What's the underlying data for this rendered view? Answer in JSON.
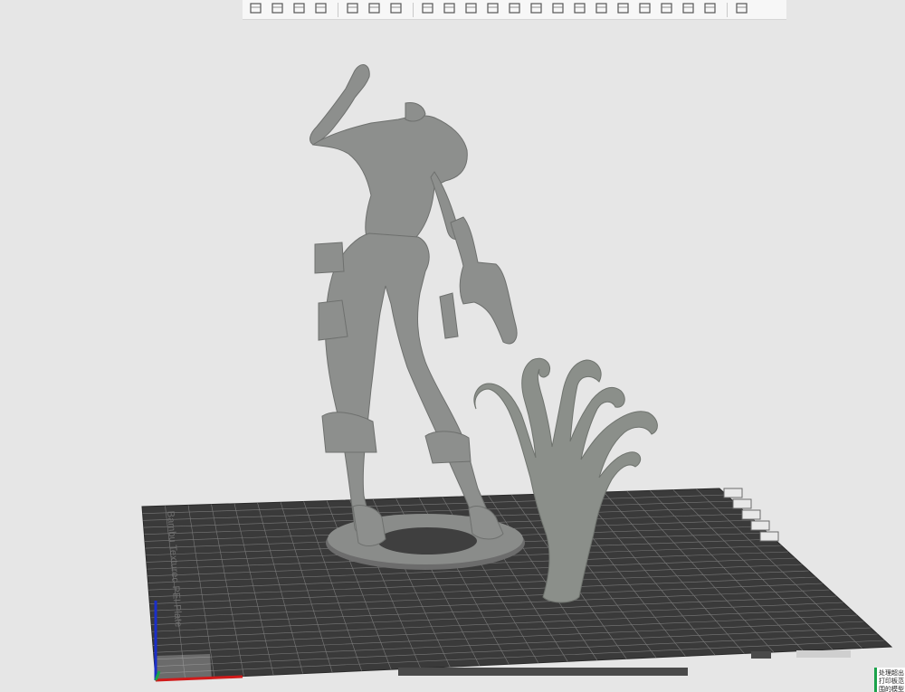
{
  "app": {
    "accent_color": "#1aa24a",
    "background_color": "#e6e6e6"
  },
  "toolbar": {
    "groups": [
      [
        "add-object-icon",
        "grid-icon",
        "auto-orient-icon",
        "arrange-icon"
      ],
      [
        "plate-icon",
        "plate-p-icon",
        "list-icon"
      ],
      [
        "move-icon",
        "rotate-icon",
        "scale-icon",
        "lay-flat-icon",
        "cut-icon",
        "split-icon",
        "mirror-icon",
        "support-paint-icon",
        "seam-icon",
        "text-emboss-icon",
        "measure-icon",
        "brim-ears-icon",
        "assembly-icon",
        "bounding-box-icon"
      ],
      [
        "variable-layer-icon"
      ]
    ]
  },
  "plate": {
    "label": "Bambu Textured PEI Plate",
    "grid_color": "#8a8a8a",
    "plate_color": "#3a3a3a",
    "side_buttons": [
      "close-plate-icon",
      "orient-plate-icon",
      "arrange-plate-icon",
      "lock-plate-icon",
      "settings-plate-icon"
    ]
  },
  "axes": {
    "x_color": "#d01a1a",
    "y_color": "#1aa24a",
    "z_color": "#1b2fc9"
  },
  "status": {
    "message": "处理超出打印板范围的模型"
  }
}
